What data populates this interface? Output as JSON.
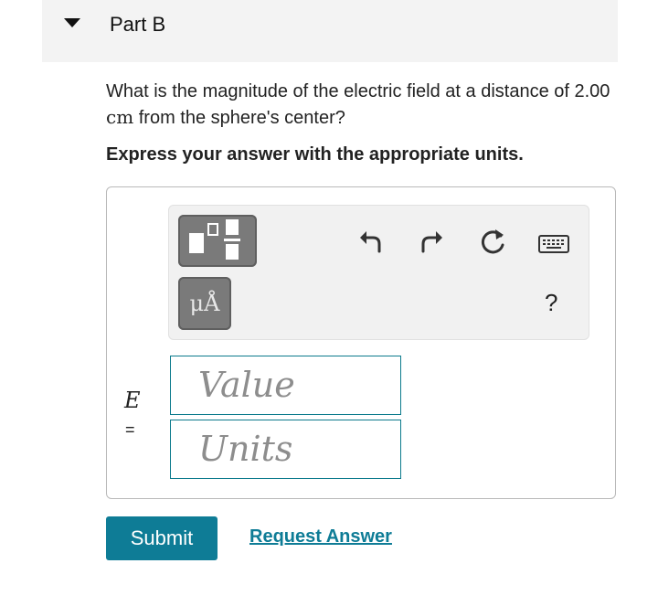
{
  "part": {
    "title": "Part B"
  },
  "question": {
    "text_before": "What is the magnitude of the electric field at a distance of 2.00",
    "unit": "cm",
    "text_after": "from the sphere's center?"
  },
  "instruction": "Express your answer with the appropriate units.",
  "toolbar": {
    "units_button_label": "μÅ",
    "help_label": "?",
    "icons": [
      "templates-icon",
      "units-icon",
      "undo-icon",
      "redo-icon",
      "reset-icon",
      "keyboard-icon",
      "help-icon"
    ]
  },
  "answer": {
    "variable": "E",
    "equals": "=",
    "value_placeholder": "Value",
    "units_placeholder": "Units"
  },
  "actions": {
    "submit_label": "Submit",
    "request_label": "Request Answer"
  },
  "colors": {
    "accent": "#0e7c96",
    "header_bg": "#f3f3f3",
    "toolbar_bg": "#f1f1f1",
    "tool_button": "#7a7a7a"
  }
}
